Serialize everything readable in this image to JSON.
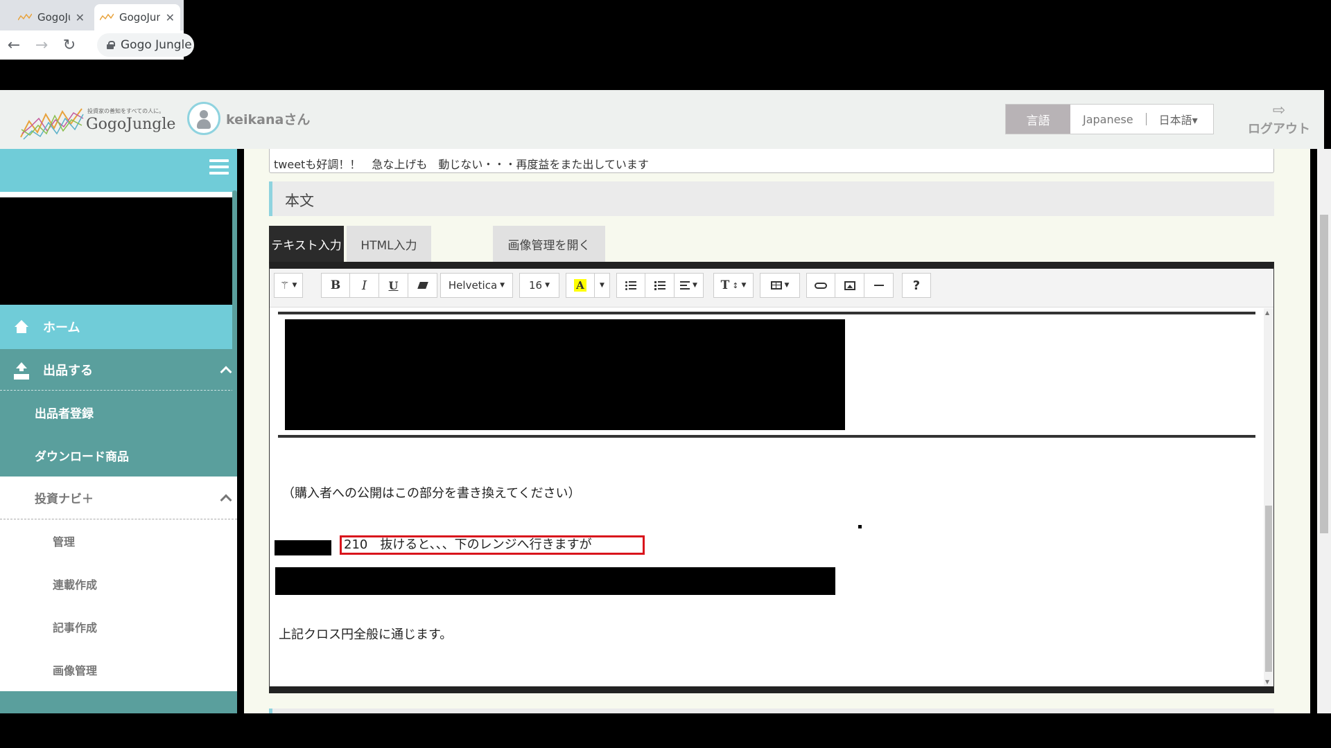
{
  "browser": {
    "tabs": [
      {
        "title": "GogoJungle",
        "active": false
      },
      {
        "title": "GogoJungle",
        "active": true
      }
    ],
    "address": "Gogo Jungle"
  },
  "header": {
    "logo_tagline": "投資家の善知をすべての人に。",
    "logo_brand": "GogoJungle",
    "username": "keikanaさん",
    "language_label": "言語",
    "language_option": "Japanese",
    "language_current": "日本語▾",
    "logout_label": "ログアウト"
  },
  "sidebar": {
    "home": "ホーム",
    "sell": "出品する",
    "seller_registration": "出品者登録",
    "download_products": "ダウンロード商品",
    "investment_navi": "投資ナビ＋",
    "manage": "管理",
    "series": "連載作成",
    "article": "記事作成",
    "images": "画像管理"
  },
  "main": {
    "title_value": "tweetも好調！！　急な上げも　動じない・・・再度益をまた出しています",
    "body_heading": "本文",
    "tabs": {
      "text_input": "テキスト入力",
      "html_input": "HTML入力",
      "open_images": "画像管理を開く"
    }
  },
  "editor": {
    "toolbar": {
      "font_name": "Helvetica",
      "font_size": "16",
      "bold": "B",
      "italic": "I",
      "underline": "U",
      "highlight": "A",
      "help": "?",
      "text_size": "T"
    },
    "content": {
      "note": "（購入者への公開はこの部分を書き換えてください）",
      "highlighted_line": "210　抜けると、、、下のレンジへ行きますが",
      "cross_yen": "上記クロス円全般に通じます。"
    }
  },
  "colors": {
    "accent_teal": "#70ccd8",
    "sidebar_dark_teal": "#5a9f9d",
    "highlight_red": "#d9141c"
  }
}
